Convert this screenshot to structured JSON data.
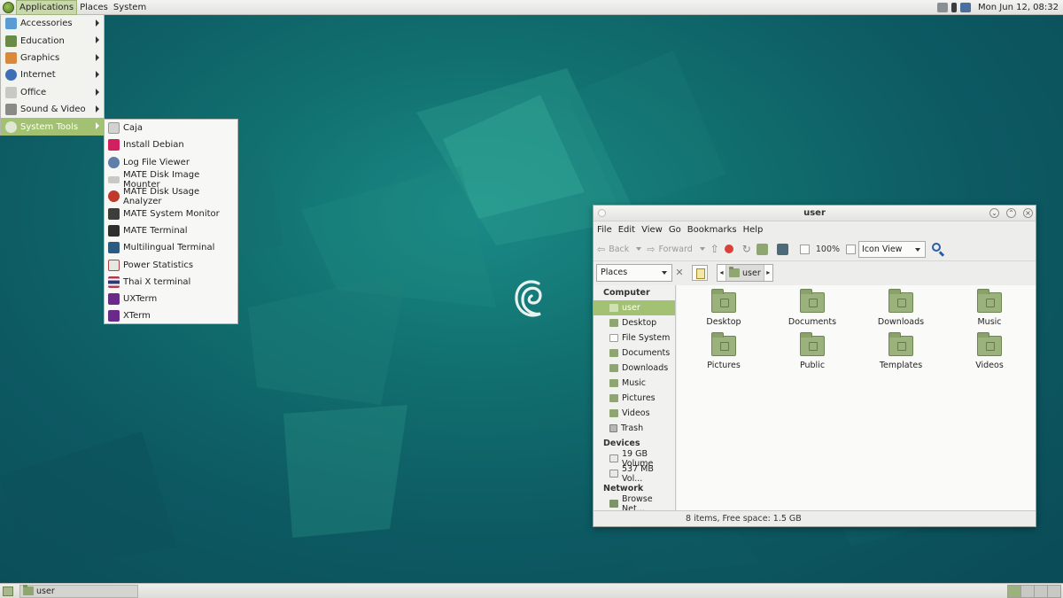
{
  "top_panel": {
    "menus": [
      "Applications",
      "Places",
      "System"
    ],
    "clock": "Mon Jun 12, 08:32"
  },
  "apps_menu": {
    "items": [
      {
        "label": "Accessories",
        "icon": "accessories-icon",
        "color": "#5a9bd4"
      },
      {
        "label": "Education",
        "icon": "education-icon",
        "color": "#6a8a4a"
      },
      {
        "label": "Graphics",
        "icon": "graphics-icon",
        "color": "#d9893a"
      },
      {
        "label": "Internet",
        "icon": "internet-icon",
        "color": "#3d6fb4"
      },
      {
        "label": "Office",
        "icon": "office-icon",
        "color": "#c9c9c4"
      },
      {
        "label": "Sound & Video",
        "icon": "sound-video-icon",
        "color": "#8a8a86"
      },
      {
        "label": "System Tools",
        "icon": "system-tools-icon",
        "color": "#e0e6d4"
      }
    ],
    "selected_index": 6
  },
  "system_tools_menu": {
    "items": [
      {
        "label": "Caja",
        "icon": "caja-icon",
        "color": "#d2d2ce"
      },
      {
        "label": "Install Debian",
        "icon": "install-debian-icon",
        "color": "#d1205f"
      },
      {
        "label": "Log File Viewer",
        "icon": "log-viewer-icon",
        "color": "#5f7fa8"
      },
      {
        "label": "MATE Disk Image Mounter",
        "icon": "disk-image-icon",
        "color": "#c8c8c4"
      },
      {
        "label": "MATE Disk Usage Analyzer",
        "icon": "disk-usage-icon",
        "color": "#c0392b"
      },
      {
        "label": "MATE System Monitor",
        "icon": "system-monitor-icon",
        "color": "#3d3d3a"
      },
      {
        "label": "MATE Terminal",
        "icon": "terminal-icon",
        "color": "#2e2e2c"
      },
      {
        "label": "Multilingual Terminal",
        "icon": "multilingual-terminal-icon",
        "color": "#2c5b82"
      },
      {
        "label": "Power Statistics",
        "icon": "power-stats-icon",
        "color": "#e6e6e2"
      },
      {
        "label": "Thai X terminal",
        "icon": "thai-flag-icon",
        "color": "#b33a4c"
      },
      {
        "label": "UXTerm",
        "icon": "uxterm-icon",
        "color": "#6a2a8a"
      },
      {
        "label": "XTerm",
        "icon": "xterm-icon",
        "color": "#6a2a8a"
      }
    ]
  },
  "caja": {
    "title": "user",
    "menubar": [
      "File",
      "Edit",
      "View",
      "Go",
      "Bookmarks",
      "Help"
    ],
    "toolbar": {
      "back": "Back",
      "forward": "Forward",
      "zoom": "100%",
      "view_mode": "Icon View"
    },
    "location": {
      "side_pane": "Places",
      "path": "user"
    },
    "sidebar": {
      "sections": [
        {
          "header": "Computer",
          "items": [
            {
              "label": "user",
              "kind": "folder"
            },
            {
              "label": "Desktop",
              "kind": "folder"
            },
            {
              "label": "File System",
              "kind": "fs"
            },
            {
              "label": "Documents",
              "kind": "folder"
            },
            {
              "label": "Downloads",
              "kind": "folder"
            },
            {
              "label": "Music",
              "kind": "folder"
            },
            {
              "label": "Pictures",
              "kind": "folder"
            },
            {
              "label": "Videos",
              "kind": "folder"
            },
            {
              "label": "Trash",
              "kind": "trash"
            }
          ]
        },
        {
          "header": "Devices",
          "items": [
            {
              "label": "19 GB Volume",
              "kind": "drive"
            },
            {
              "label": "537 MB Vol...",
              "kind": "drive"
            }
          ]
        },
        {
          "header": "Network",
          "items": [
            {
              "label": "Browse Net...",
              "kind": "net"
            }
          ]
        }
      ],
      "selected": "user"
    },
    "files": [
      "Desktop",
      "Documents",
      "Downloads",
      "Music",
      "Pictures",
      "Public",
      "Templates",
      "Videos"
    ],
    "status": "8 items, Free space: 1.5 GB"
  },
  "bottom_panel": {
    "task": "user"
  },
  "colors": {
    "accent": "#a2c173",
    "desktop": "#0e5560"
  }
}
